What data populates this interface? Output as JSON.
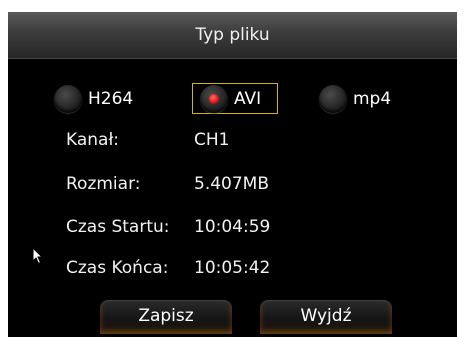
{
  "dialog": {
    "title": "Typ pliku"
  },
  "file_type": {
    "options": [
      {
        "label": "H264",
        "selected": false
      },
      {
        "label": "AVI",
        "selected": true
      },
      {
        "label": "mp4",
        "selected": false
      }
    ]
  },
  "info": {
    "channel_label": "Kanał:",
    "channel_value": "CH1",
    "size_label": "Rozmiar:",
    "size_value": "5.407MB",
    "start_label": "Czas Startu:",
    "start_value": "10:04:59",
    "end_label": "Czas Końca:",
    "end_value": "10:05:42"
  },
  "buttons": {
    "save_label": "Zapisz",
    "exit_label": "Wyjdź"
  },
  "colors": {
    "background": "#000000",
    "title_bar": "#3c3c3c",
    "focus_border": "#d4b21a",
    "selected_dot": "#e01010",
    "button_glow": "#c8781e"
  },
  "icons": {
    "cursor": "mouse-pointer-icon"
  }
}
